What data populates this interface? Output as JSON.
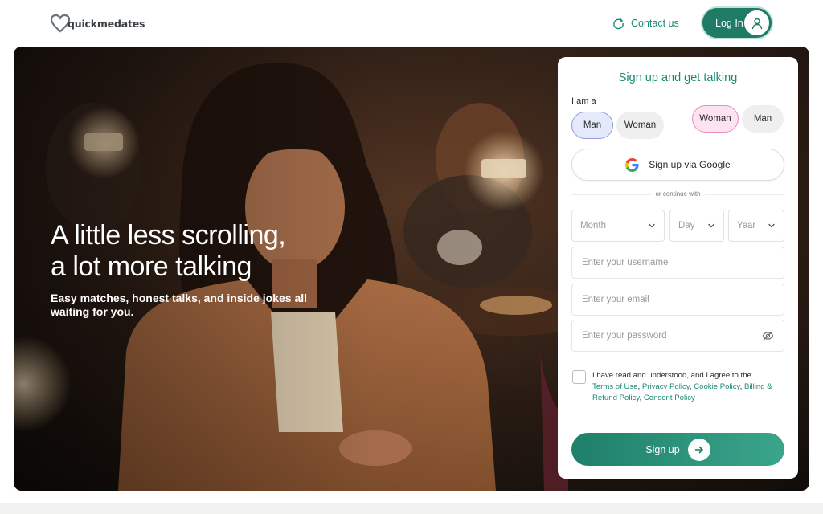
{
  "header": {
    "logo_text": "quickmedates",
    "contact_label": "Contact us",
    "login_label": "Log In"
  },
  "hero": {
    "title_line1": "A little less scrolling,",
    "title_line2": "a lot more talking",
    "subtitle": "Easy matches, honest talks, and inside jokes all waiting for you."
  },
  "form": {
    "title": "Sign up and get talking",
    "iam_label": "I am a",
    "gender_self": [
      {
        "label": "Man",
        "selected": true
      },
      {
        "label": "Woman",
        "selected": false
      }
    ],
    "gender_seek": [
      {
        "label": "Woman",
        "selected": true
      },
      {
        "label": "Man",
        "selected": false
      }
    ],
    "google_label": "Sign up via Google",
    "divider_text": "or continue with",
    "month_placeholder": "Month",
    "day_placeholder": "Day",
    "year_placeholder": "Year",
    "username_placeholder": "Enter your username",
    "email_placeholder": "Enter your email",
    "password_placeholder": "Enter your password",
    "terms_prefix": "I have read and understood, and I agree to the",
    "terms_links": [
      "Terms of Use",
      "Privacy Policy",
      "Cookie Policy",
      "Billing & Refund Policy",
      "Consent Policy"
    ],
    "signup_label": "Sign up"
  },
  "colors": {
    "brand_green": "#1f7a66",
    "accent_green": "#1a8a74",
    "selected_blue": "#e4e9fb",
    "selected_pink": "#fde3f1"
  }
}
